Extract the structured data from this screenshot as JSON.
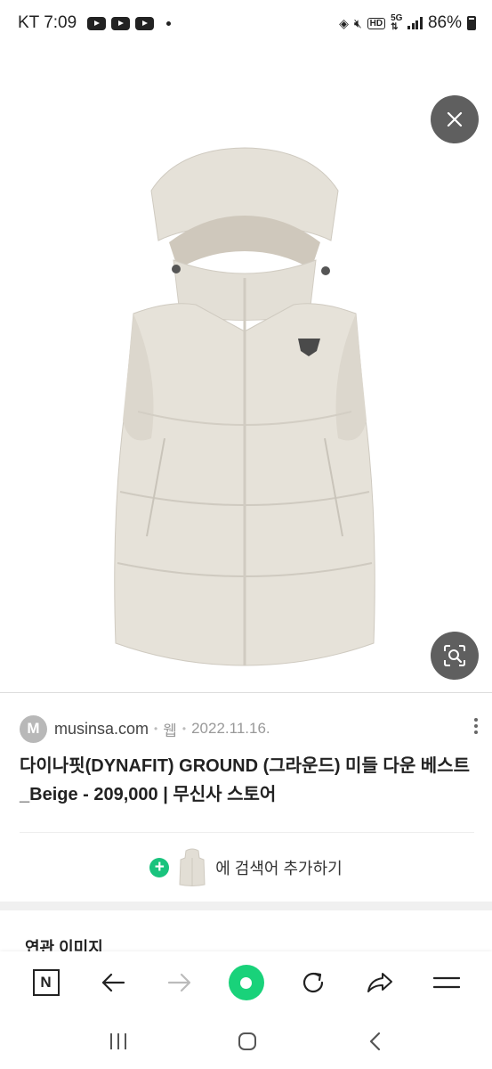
{
  "status_bar": {
    "time": "KT 7:09",
    "battery": "86%"
  },
  "image_viewer": {
    "image_alt": "다이나핏 GROUND 미들 다운 베스트 Beige"
  },
  "result": {
    "source_logo": "M",
    "site": "musinsa.com",
    "type": "웹",
    "date": "2022.11.16.",
    "title": "다이나핏(DYNAFIT) GROUND (그라운드) 미들 다운 베스트_Beige - 209,000 | 무신사 스토어",
    "add_search_label": "에 검색어 추가하기"
  },
  "related": {
    "title": "연관 이미지"
  },
  "icons": [
    "close-icon",
    "lens-search-icon",
    "more-vert-icon",
    "n-home-icon",
    "back-arrow-icon",
    "forward-arrow-icon",
    "green-dot-icon",
    "refresh-icon",
    "share-icon",
    "menu-icon",
    "recent-apps-icon",
    "home-icon",
    "nav-back-icon"
  ],
  "colors": {
    "accent_green": "#19d27a",
    "overlay_button": "#5f5f5f"
  }
}
